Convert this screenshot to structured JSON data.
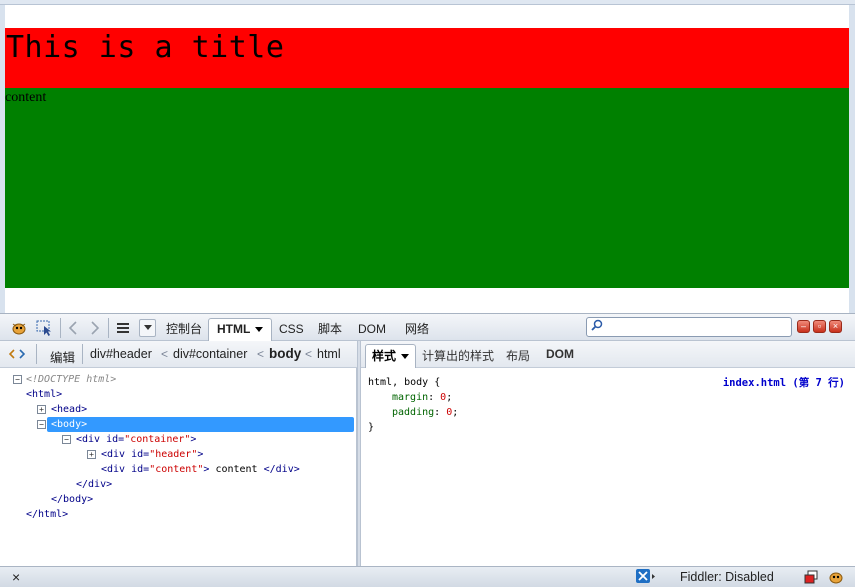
{
  "page": {
    "title": "This is a title",
    "content": "content",
    "colors": {
      "header": "#ff0000",
      "content": "#008000"
    }
  },
  "toolbar": {
    "tabs": [
      "控制台",
      "HTML",
      "CSS",
      "脚本",
      "DOM",
      "网络"
    ],
    "active_tab": "HTML",
    "search_value": ""
  },
  "breadcrumbs": {
    "edit_label": "编辑",
    "items": [
      "div#header",
      "div#container",
      "body",
      "html"
    ],
    "separator": "<"
  },
  "html_tree": {
    "doctype": "<!DOCTYPE html>",
    "html_open": "<html>",
    "head": "<head>",
    "body_open": "<body>",
    "container_open": "<div",
    "id_attr": "id=",
    "container_id": "\"container\"",
    "header_id": "\"header\"",
    "content_id": "\"content\"",
    "gt": ">",
    "content_text": "content",
    "div_close": "</div>",
    "body_close": "</body>",
    "html_close": "</html>"
  },
  "side_panel": {
    "tabs": [
      "样式",
      "计算出的样式",
      "布局",
      "DOM"
    ],
    "active_tab": "样式",
    "source": "index.html (第 7 行)",
    "selector": "html, body {",
    "rules": [
      {
        "prop": "margin",
        "value": "0"
      },
      {
        "prop": "padding",
        "value": "0"
      }
    ],
    "close_brace": "}"
  },
  "status_bar": {
    "close_label": "×",
    "fiddler": "Fiddler: Disabled"
  }
}
